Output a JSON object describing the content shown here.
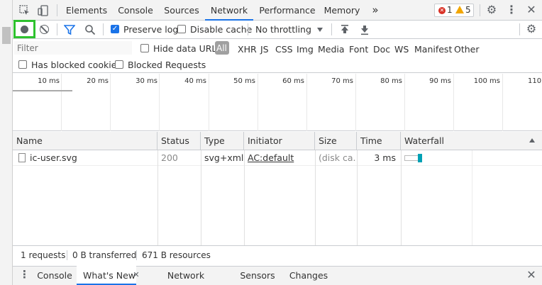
{
  "tabs": [
    {
      "label": "Elements"
    },
    {
      "label": "Console"
    },
    {
      "label": "Sources"
    },
    {
      "label": "Network",
      "active": true
    },
    {
      "label": "Performance"
    },
    {
      "label": "Memory"
    }
  ],
  "more_tabs_glyph": "»",
  "errors": {
    "count": "1",
    "color": "#d93025"
  },
  "warnings": {
    "count": "5",
    "color": "#f2a600"
  },
  "toolbar": {
    "preserve_log": {
      "label": "Preserve log",
      "checked": true
    },
    "disable_cache": {
      "label": "Disable cache",
      "checked": false
    },
    "throttling": {
      "value": "No throttling"
    }
  },
  "filter": {
    "placeholder": "Filter",
    "hide_data_urls": {
      "label": "Hide data URLs",
      "checked": false
    },
    "types": [
      "All",
      "XHR",
      "JS",
      "CSS",
      "Img",
      "Media",
      "Font",
      "Doc",
      "WS",
      "Manifest",
      "Other"
    ],
    "has_blocked_cookies": {
      "label": "Has blocked cookies",
      "checked": false
    },
    "blocked_requests": {
      "label": "Blocked Requests",
      "checked": false
    }
  },
  "overview": {
    "ticks": [
      "10 ms",
      "20 ms",
      "30 ms",
      "40 ms",
      "50 ms",
      "60 ms",
      "70 ms",
      "80 ms",
      "90 ms",
      "100 ms",
      "110 ms"
    ]
  },
  "table": {
    "columns": [
      "Name",
      "Status",
      "Type",
      "Initiator",
      "Size",
      "Time",
      "Waterfall"
    ],
    "rows": [
      {
        "name": "ic-user.svg",
        "status": "200",
        "type": "svg+xml",
        "initiator": "AC:default",
        "size": "(disk ca...",
        "time": "3 ms"
      }
    ]
  },
  "status": {
    "requests": "1 requests",
    "transferred": "0 B transferred",
    "resources": "671 B resources"
  },
  "drawer": {
    "tabs": [
      {
        "label": "Console"
      },
      {
        "label": "What's New",
        "active": true
      },
      {
        "label": "Network conditions"
      },
      {
        "label": "Sensors"
      },
      {
        "label": "Changes"
      }
    ]
  },
  "colors": {
    "accent": "#1a73e8",
    "highlight": "#2ec22e",
    "waterfall_bar": "#00a1b5"
  }
}
